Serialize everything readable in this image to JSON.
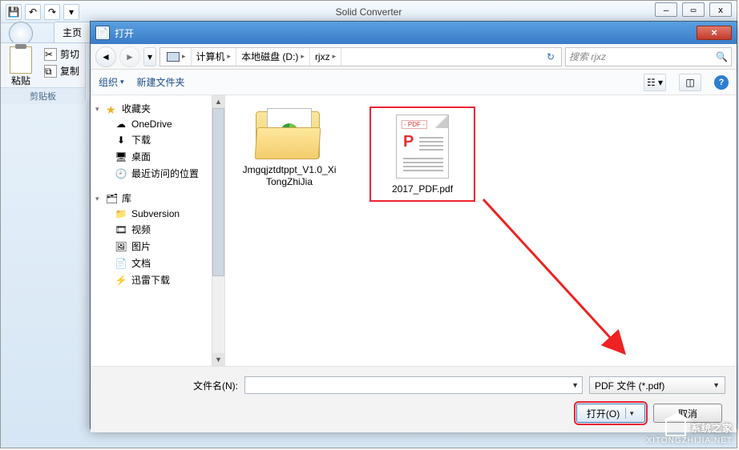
{
  "app": {
    "title": "Solid Converter",
    "winctrls": {
      "min": "—",
      "max": "▭",
      "close": "x"
    },
    "help": "?"
  },
  "ribbon": {
    "tabs": [
      "主页"
    ],
    "paste_label": "粘贴",
    "cut_label": "剪切",
    "copy_label": "复制",
    "group_clipboard": "剪贴板"
  },
  "dialog": {
    "title": "打开",
    "close_glyph": "×",
    "crumbs": [
      "计算机",
      "本地磁盘 (D:)",
      "rjxz"
    ],
    "search_placeholder": "搜索 rjxz",
    "toolbar": {
      "organize": "组织",
      "newfolder": "新建文件夹"
    },
    "tree": {
      "favorites": {
        "label": "收藏夹",
        "items": [
          "OneDrive",
          "下载",
          "桌面",
          "最近访问的位置"
        ]
      },
      "libraries": {
        "label": "库",
        "items": [
          "Subversion",
          "视频",
          "图片",
          "文档",
          "迅雷下载"
        ]
      }
    },
    "files": [
      {
        "name": "Jmgqjztdtppt_V1.0_XiTongZhiJia",
        "kind": "folder"
      },
      {
        "name": "2017_PDF.pdf",
        "kind": "pdf"
      }
    ],
    "filename_label": "文件名(N):",
    "filename_value": "",
    "filetype": "PDF 文件 (*.pdf)",
    "open_btn": "打开(O)",
    "cancel_btn": "取消"
  },
  "watermark": {
    "brand": "系统之家",
    "url": "XITONGZHIJIA.NET"
  }
}
